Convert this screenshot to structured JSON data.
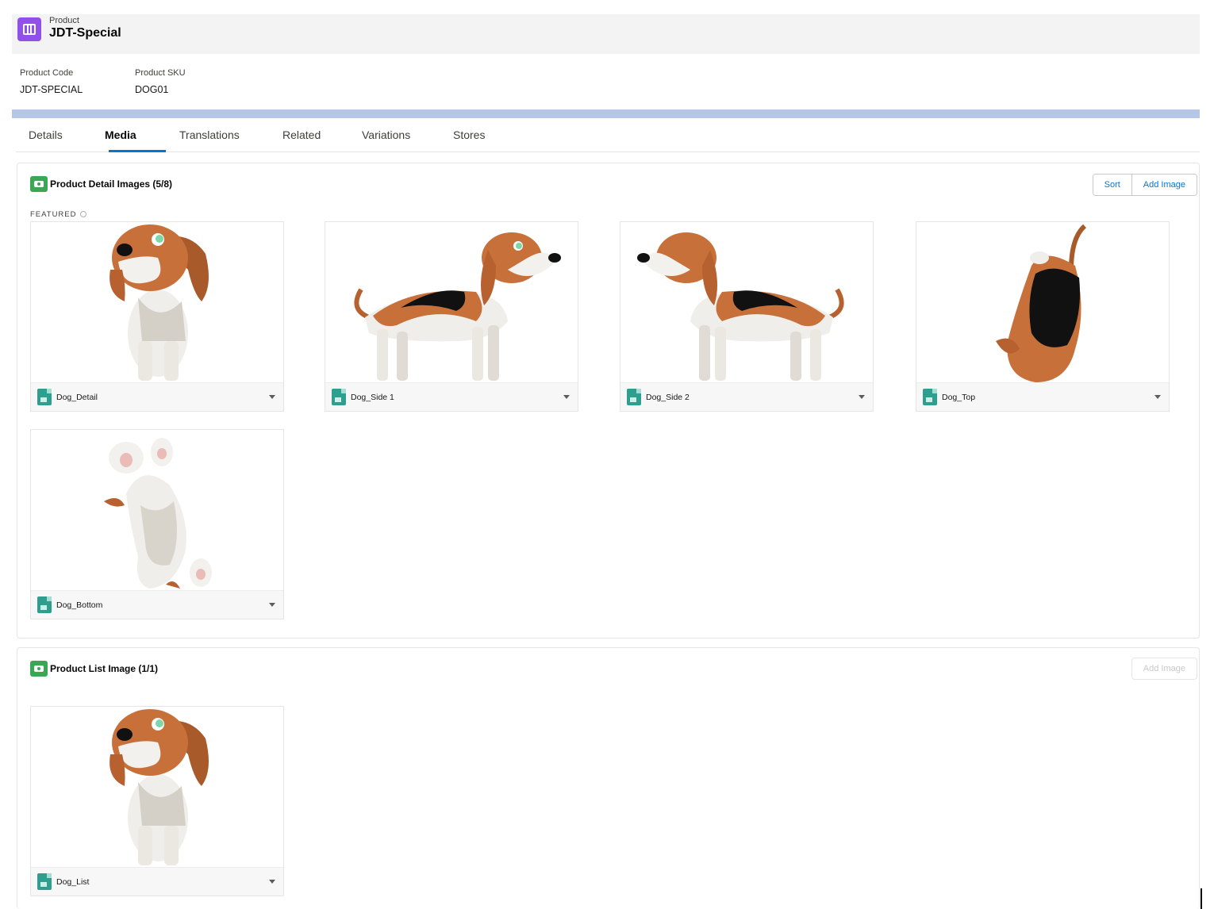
{
  "header": {
    "object_label": "Product",
    "record_title": "JDT-Special",
    "icon": "product-icon"
  },
  "fields": [
    {
      "label": "Product Code",
      "value": "JDT-SPECIAL"
    },
    {
      "label": "Product SKU",
      "value": "DOG01"
    }
  ],
  "tabs": [
    {
      "label": "Details"
    },
    {
      "label": "Media",
      "active": true
    },
    {
      "label": "Translations"
    },
    {
      "label": "Related"
    },
    {
      "label": "Variations"
    },
    {
      "label": "Stores"
    }
  ],
  "detail_images": {
    "title": "Product Detail Images (5/8)",
    "featured_label": "FEATURED",
    "sort_label": "Sort",
    "add_label": "Add Image",
    "images": [
      {
        "name": "Dog_Detail",
        "view": "front"
      },
      {
        "name": "Dog_Side 1",
        "view": "side-right"
      },
      {
        "name": "Dog_Side 2",
        "view": "side-left"
      },
      {
        "name": "Dog_Top",
        "view": "top"
      },
      {
        "name": "Dog_Bottom",
        "view": "bottom"
      }
    ]
  },
  "list_image": {
    "title": "Product List Image (1/1)",
    "add_label": "Add Image",
    "images": [
      {
        "name": "Dog_List",
        "view": "front"
      }
    ]
  },
  "colors": {
    "accent": "#0176d3",
    "product_icon": "#9050e9",
    "media_icon": "#3ba755",
    "file_icon": "#2e9e8e",
    "dog_brown": "#c8703a",
    "dog_white": "#f2f0ec"
  }
}
